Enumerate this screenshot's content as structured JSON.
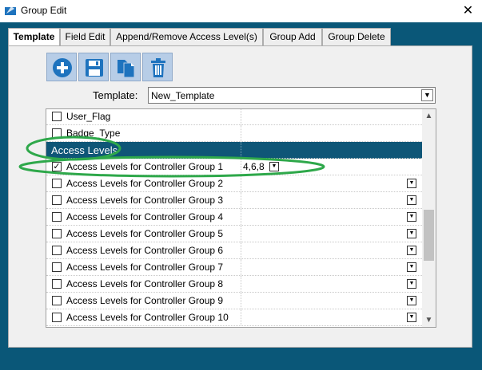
{
  "window": {
    "title": "Group Edit",
    "close_glyph": "✕"
  },
  "tabs": [
    {
      "label": "Template",
      "active": true
    },
    {
      "label": "Field Edit"
    },
    {
      "label": "Append/Remove Access Level(s)"
    },
    {
      "label": "Group Add"
    },
    {
      "label": "Group Delete"
    }
  ],
  "toolbar": {
    "icons": [
      "add-icon",
      "save-icon",
      "copy-icon",
      "delete-icon"
    ]
  },
  "template": {
    "label": "Template:",
    "selected": "New_Template",
    "arrow_glyph": "▼"
  },
  "grid": {
    "rows": [
      {
        "label": "User_Flag",
        "checked": false
      },
      {
        "label": "Badge_Type",
        "checked": false
      },
      {
        "label": "Access Levels",
        "header": true
      },
      {
        "label": "Access Levels for Controller Group 1",
        "checked": true,
        "value": "4,6,8"
      },
      {
        "label": "Access Levels for Controller Group 2",
        "checked": false
      },
      {
        "label": "Access Levels for Controller Group 3",
        "checked": false
      },
      {
        "label": "Access Levels for Controller Group 4",
        "checked": false
      },
      {
        "label": "Access Levels for Controller Group 5",
        "checked": false
      },
      {
        "label": "Access Levels for Controller Group 6",
        "checked": false
      },
      {
        "label": "Access Levels for Controller Group 7",
        "checked": false
      },
      {
        "label": "Access Levels for Controller Group 8",
        "checked": false
      },
      {
        "label": "Access Levels for Controller Group 9",
        "checked": false
      },
      {
        "label": "Access Levels for Controller Group 10",
        "checked": false
      }
    ],
    "check_glyph": "✓",
    "dropdown_glyph": "▼",
    "scroll_up_glyph": "▲",
    "scroll_down_glyph": "▼"
  },
  "colors": {
    "frame": "#0a5778",
    "header_row": "#0f5677",
    "toolbar_button": "#b7cde7",
    "icon_blue": "#1e73be",
    "highlight_ellipse": "#2ea84a"
  }
}
